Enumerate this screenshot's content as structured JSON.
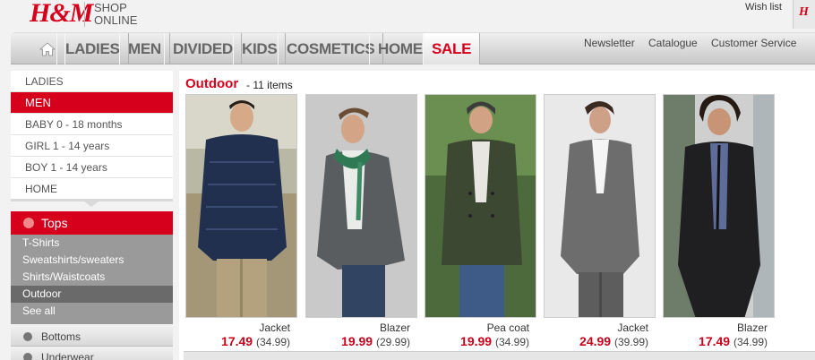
{
  "header": {
    "logo": "H&M",
    "shop_online": "SHOP ONLINE",
    "wishlist": "Wish list"
  },
  "topnav": {
    "items": [
      "LADIES",
      "MEN",
      "DIVIDED",
      "KIDS",
      "COSMETICS",
      "HOME",
      "SALE"
    ],
    "util_links": [
      "Newsletter",
      "Catalogue",
      "Customer Service"
    ]
  },
  "leftnav": {
    "items": [
      {
        "label": "LADIES",
        "active": false
      },
      {
        "label": "MEN",
        "active": true
      },
      {
        "label": "BABY 0 - 18 months",
        "active": false
      },
      {
        "label": "GIRL 1 - 14 years",
        "active": false
      },
      {
        "label": "BOY 1 - 14 years",
        "active": false
      },
      {
        "label": "HOME",
        "active": false
      }
    ],
    "tops_label": "Tops",
    "tops_items": [
      "T-Shirts",
      "Sweatshirts/sweaters",
      "Shirts/Waistcoats",
      "Outdoor",
      "See all"
    ],
    "selected_sub": "Outdoor",
    "collapsed": [
      "Bottoms",
      "Underwear"
    ]
  },
  "main": {
    "category_title": "Outdoor",
    "item_count": "- 11 items",
    "products": [
      {
        "name": "Jacket",
        "price": "17.49",
        "old_price": "(34.99)"
      },
      {
        "name": "Blazer",
        "price": "19.99",
        "old_price": "(29.99)"
      },
      {
        "name": "Pea coat",
        "price": "19.99",
        "old_price": "(34.99)"
      },
      {
        "name": "Jacket",
        "price": "24.99",
        "old_price": "(39.99)"
      },
      {
        "name": "Blazer",
        "price": "17.49",
        "old_price": "(34.99)"
      }
    ]
  },
  "colors": {
    "brand_red": "#d6001c",
    "sale_red": "#c8001a",
    "nav_gray": "#666666"
  }
}
